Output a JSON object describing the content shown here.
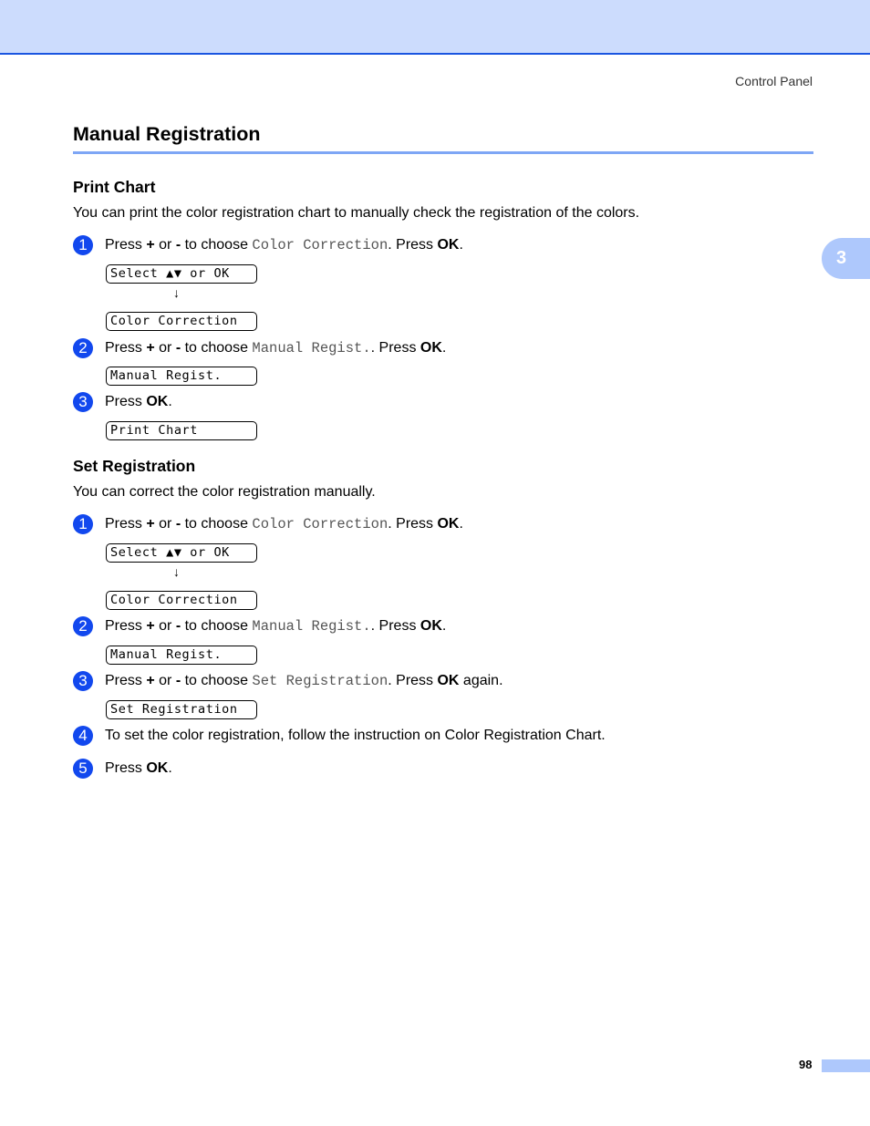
{
  "header": {
    "section_label": "Control Panel",
    "chapter_tab": "3"
  },
  "title": "Manual Registration",
  "print_chart": {
    "heading": "Print Chart",
    "intro": "You can print the color registration chart to manually check the registration of the colors.",
    "steps": [
      {
        "num": "1",
        "pre": "Press ",
        "plus": "+",
        "mid": " or ",
        "minus": "-",
        "choose": " to choose ",
        "item": "Color Correction",
        "post": ". Press ",
        "ok": "OK",
        "end": "."
      },
      {
        "num": "2",
        "pre": "Press ",
        "plus": "+",
        "mid": " or ",
        "minus": "-",
        "choose": " to choose ",
        "item": "Manual Regist.",
        "post": ". Press ",
        "ok": "OK",
        "end": "."
      },
      {
        "num": "3",
        "pre": "Press ",
        "ok": "OK",
        "end": "."
      }
    ],
    "lcd": [
      "Select ▲▼ or OK",
      "Color Correction",
      "Manual Regist.",
      "Print Chart"
    ],
    "arrow": "↓"
  },
  "set_registration": {
    "heading": "Set Registration",
    "intro": "You can correct the color registration manually.",
    "steps": [
      {
        "num": "1",
        "pre": "Press ",
        "plus": "+",
        "mid": " or ",
        "minus": "-",
        "choose": " to choose ",
        "item": "Color Correction",
        "post": ". Press ",
        "ok": "OK",
        "end": "."
      },
      {
        "num": "2",
        "pre": "Press ",
        "plus": "+",
        "mid": " or ",
        "minus": "-",
        "choose": " to choose ",
        "item": "Manual Regist.",
        "post": ". Press ",
        "ok": "OK",
        "end": "."
      },
      {
        "num": "3",
        "pre": "Press ",
        "plus": "+",
        "mid": " or ",
        "minus": "-",
        "choose": " to choose ",
        "item": "Set Registration",
        "post": ". Press ",
        "ok": "OK",
        "end": " again."
      },
      {
        "num": "4",
        "text": "To set the color registration, follow the instruction on Color Registration Chart."
      },
      {
        "num": "5",
        "pre": "Press ",
        "ok": "OK",
        "end": "."
      }
    ],
    "lcd": [
      "Select ▲▼ or OK",
      "Color Correction",
      "Manual Regist.",
      "Set Registration"
    ],
    "arrow": "↓"
  },
  "footer": {
    "page_number": "98"
  }
}
